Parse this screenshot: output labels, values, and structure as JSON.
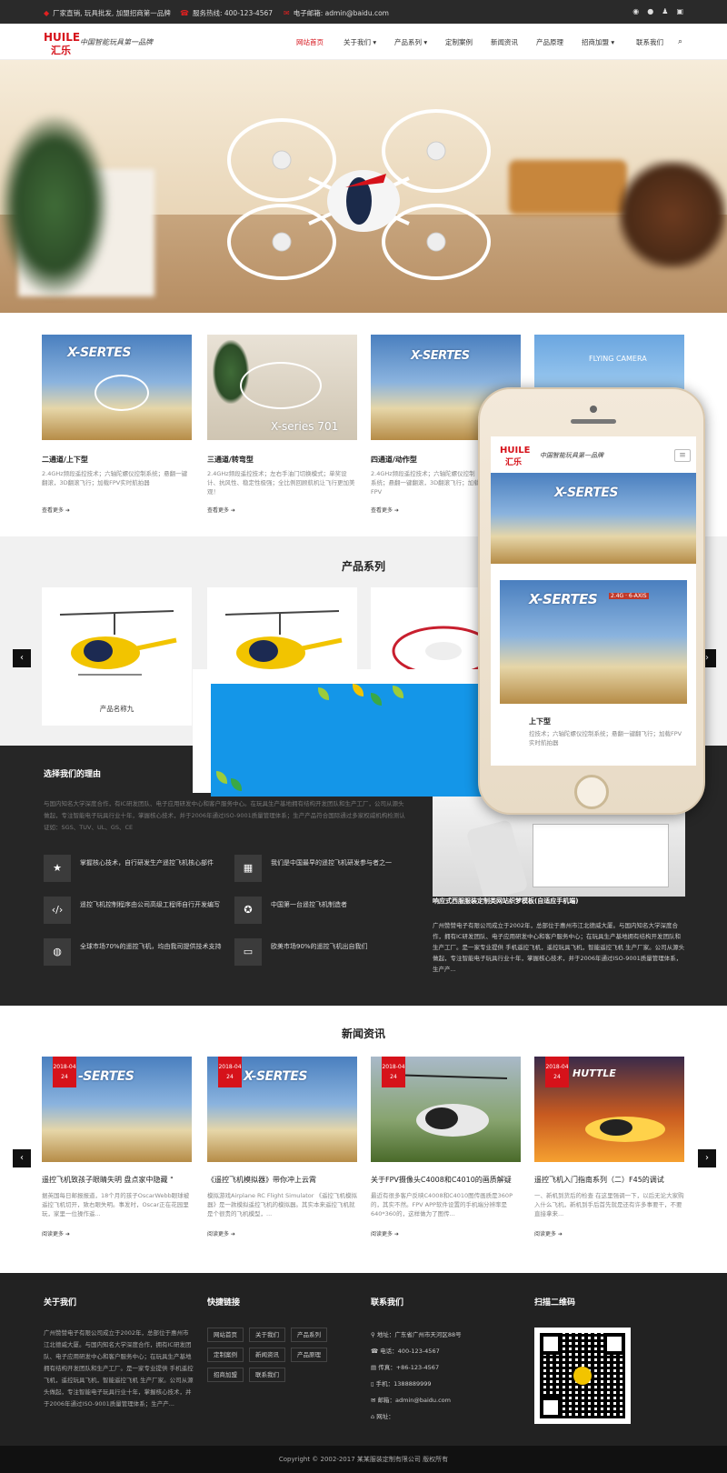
{
  "topbar": {
    "items": [
      "厂家直销, 玩具批发, 加盟招商第一品牌",
      "服务热线: 400-123-4567",
      "电子邮箱: admin@baidu.com"
    ],
    "social_icons": [
      "weibo-icon",
      "wechat-icon",
      "qq-icon",
      "cart-icon"
    ]
  },
  "header": {
    "logo_text1": "HUILE",
    "logo_text2": "汇乐",
    "slogan": "中国智能玩具第一品牌",
    "nav": [
      {
        "label": "网站首页",
        "active": true
      },
      {
        "label": "关于我们 ▾"
      },
      {
        "label": "产品系列 ▾"
      },
      {
        "label": "定制案例"
      },
      {
        "label": "新闻资讯"
      },
      {
        "label": "产品原理"
      },
      {
        "label": "招商加盟 ▾"
      },
      {
        "label": "联系我们"
      }
    ]
  },
  "featured": [
    {
      "title": "二通道/上下型",
      "desc": "2.4GHz频段遥控技术；六轴陀螺仪控制系统；悬翻一键翻滚，3D翻滚飞行；加载FPV实时航拍器",
      "more": "查看更多 ➜",
      "caption": "X-SERTES"
    },
    {
      "title": "三通道/转弯型",
      "desc": "2.4GHz频段遥控技术；左右手油门切换模式；单奖设计、抗风性、稳定性极强；全比例回顾航机让飞行更加美观！",
      "more": "查看更多 ➜",
      "caption": "X-series 701"
    },
    {
      "title": "四通道/动作型",
      "desc": "2.4GHz频段遥控技术；六轴陀螺仪控制系统；悬翻一键翻滚，3D翻滚飞行；加载FPV",
      "more": "查看更多 ➜",
      "caption": "X-SERTES"
    },
    {
      "title": "",
      "desc": "",
      "more": "",
      "caption": "FLYING CAMERA"
    }
  ],
  "products": {
    "title": "产品系列",
    "items": [
      {
        "name": "产品名称九"
      },
      {
        "name": ""
      },
      {
        "name": ""
      }
    ]
  },
  "why": {
    "title": "选择我们的理由",
    "desc": "与国内知名大学深度合作，有IC研发团队、电子应用研发中心和客户服务中心。在玩具生产基地拥有结构开发团队和生产工厂，公司从源头做起，专注智能电子玩具行业十年，掌握核心技术，并于2006年通过ISO-9001质量管理体系；生产产品符合国际通过多家权威机构检测认证如：SGS、TUV、UL、GS、CE",
    "features": [
      {
        "icon": "star-icon",
        "text": "掌握核心技术，自行研发生产遥控飞机核心部件"
      },
      {
        "icon": "calendar-icon",
        "text": "我们是中国最早的遥控飞机研发参与者之一"
      },
      {
        "icon": "code-icon",
        "text": "遥控飞机控制程序由公司高级工程师自行开发编写"
      },
      {
        "icon": "badge-icon",
        "text": "中国第一台遥控飞机制造者"
      },
      {
        "icon": "globe-icon",
        "text": "全球市场70%的遥控飞机，均由我司提供技术支持"
      },
      {
        "icon": "money-icon",
        "text": "欧美市场90%的遥控飞机出自我们"
      }
    ],
    "right_title": "响应式西服服装定制类网站织梦模板(自适应手机端)",
    "right_desc": "广州赞赞电子有限公司成立于2002年，总部位于惠州市江北德威大厦。与国内知名大学深度合作，拥有IC研发团队、电子应用研发中心和客户服务中心；在玩具生产基地拥有结构开发团队和生产工厂。是一家专业提供 手机遥控飞机，遥控玩具飞机，智能遥控飞机 生产厂家。公司从源头做起，专注智能电子玩具行业十年，掌握核心技术，并于2006年通过ISO-9001质量管理体系，生产产..."
  },
  "news": {
    "title": "新闻资讯",
    "items": [
      {
        "year": "2018-04",
        "day": "24",
        "title": "遥控飞机致孩子眼睛失明 盘点家中隐藏 \"",
        "desc": "据英国每日邮报报道，18个月的孩子OscarWebb眼球被遥控飞机切开，致右眼失明。事发时，Oscar正在花园里玩，家里一位操作遥...",
        "more": "阅读更多 ➜",
        "img": "x-series"
      },
      {
        "year": "2018-04",
        "day": "24",
        "title": "《遥控飞机模拟器》带你冲上云霄",
        "desc": "模拟游戏Airplane RC Flight Simulator 《遥控飞机模拟器》是一款模拟遥控飞机的模拟器。其实本来遥控飞机就是个很贵的飞机模型，...",
        "more": "阅读更多 ➜",
        "img": "x-series"
      },
      {
        "year": "2018-04",
        "day": "24",
        "title": "关于FPV摄像头C4008和C4010的画质解疑",
        "desc": "最近有很多客户反映C4008和C4010图传画质是360P的，其实不然。FPV APP软件设置的手机端分辨率是640*360的，这样做为了图传...",
        "more": "阅读更多 ➜",
        "img": "helicopter"
      },
      {
        "year": "2018-04",
        "day": "24",
        "title": "遥控飞机入门指南系列（二）F45的调试",
        "desc": "一、新机到货后的检查 在这里强调一下，以后无论大家购入什么飞机，新机到手后首先就是还有许多事要干，不要直接拿来...",
        "more": "阅读更多 ➜",
        "img": "hustle"
      }
    ]
  },
  "footer": {
    "about_title": "关于我们",
    "about_text": "广州赞赞电子有限公司成立于2002年，总部位于惠州市江北德威大厦。与国内知名大学深度合作，拥有IC研发团队、电子应用研发中心和客户服务中心；在玩具生产基地拥有结构开发团队和生产工厂。是一家专业提供 手机遥控飞机，遥控玩具飞机，智能遥控飞机 生产厂家。公司从源头做起，专注智能电子玩具行业十年，掌握核心技术，并于2006年通过ISO-9001质量管理体系；生产产...",
    "links_title": "快捷链接",
    "links": [
      "网站首页",
      "关于我们",
      "产品系列",
      "定制案例",
      "新闻资讯",
      "产品原理",
      "招商加盟",
      "联系我们"
    ],
    "contact_title": "联系我们",
    "contact": [
      {
        "icon": "pin-icon",
        "text": "地址：广东省广州市天河区88号"
      },
      {
        "icon": "phone-icon",
        "text": "电话：400-123-4567"
      },
      {
        "icon": "fax-icon",
        "text": "传真：+86-123-4567"
      },
      {
        "icon": "mobile-icon",
        "text": "手机：1388889999"
      },
      {
        "icon": "mail-icon",
        "text": "邮箱：admin@baidu.com"
      },
      {
        "icon": "home-icon",
        "text": "网址："
      }
    ],
    "qr_title": "扫描二维码",
    "copyright": "Copyright © 2002-2017 某某服装定制有限公司 版权所有"
  },
  "phone_mockup": {
    "logo_text1": "HUILE",
    "logo_text2": "汇乐",
    "slogan": "中国智能玩具第一品牌",
    "caption1": "X-SERTES",
    "caption2": "X-SERTES",
    "tagline": "2.4G · 6-AXIS",
    "overflow_title": "上下型",
    "overflow_desc": "控技术；六轴陀螺仪控制系统；悬翻一键翻飞行；加载FPV实时航拍器"
  },
  "colors": {
    "accent": "#d6121a",
    "dark": "#262626",
    "footer": "#222222"
  }
}
